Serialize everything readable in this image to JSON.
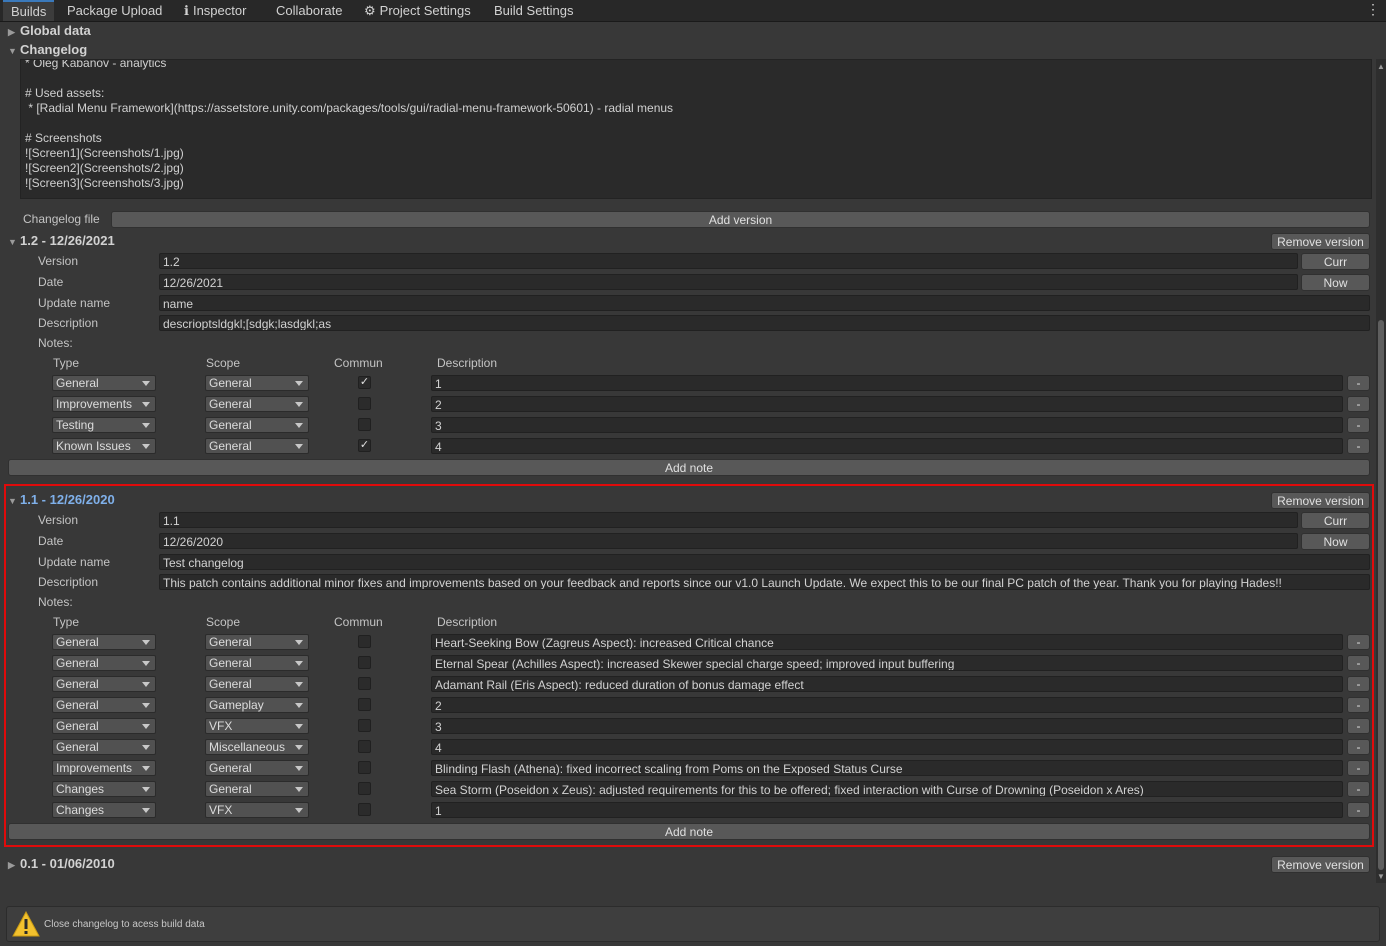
{
  "tabs": [
    "Builds",
    "Package Upload",
    "Inspector",
    "Collaborate",
    "Project Settings",
    "Build Settings"
  ],
  "tab_icons": {
    "inspector": "info-icon",
    "project_settings": "gear-icon"
  },
  "menu_glyph": "⋮",
  "sections": {
    "global_data": "Global data",
    "changelog": "Changelog"
  },
  "changelog_text": "* Oleg Kabanov - analytics\n\n# Used assets:\n * [Radial Menu Framework](https://assetstore.unity.com/packages/tools/gui/radial-menu-framework-50601) - radial menus\n\n# Screenshots\n![Screen1](Screenshots/1.jpg)\n![Screen2](Screenshots/2.jpg)\n![Screen3](Screenshots/3.jpg)",
  "changelog_file_label": "Changelog file",
  "add_version_label": "Add version",
  "labels": {
    "version": "Version",
    "date": "Date",
    "update_name": "Update name",
    "description": "Description",
    "notes": "Notes:",
    "col_type": "Type",
    "col_scope": "Scope",
    "col_commun": "Commun",
    "col_description": "Description",
    "curr": "Curr",
    "now": "Now",
    "remove_version": "Remove version",
    "add_note": "Add note",
    "minus": "-"
  },
  "versions": [
    {
      "header": "1.2 - 12/26/2021",
      "version": "1.2",
      "date": "12/26/2021",
      "update_name": "name",
      "description": "descrioptsldgkl;[sdgk;lasdgkl;as",
      "notes": [
        {
          "type": "General",
          "scope": "General",
          "commun": true,
          "description": "1"
        },
        {
          "type": "Improvements",
          "scope": "General",
          "commun": false,
          "description": "2"
        },
        {
          "type": "Testing",
          "scope": "General",
          "commun": false,
          "description": "3"
        },
        {
          "type": "Known Issues",
          "scope": "General",
          "commun": true,
          "description": "4"
        }
      ]
    },
    {
      "header": "1.1 - 12/26/2020",
      "selected": true,
      "version": "1.1",
      "date": "12/26/2020",
      "update_name": "Test changelog",
      "description": "This patch contains additional minor fixes and improvements based on your feedback and reports since our v1.0 Launch Update. We expect this to be our final PC patch of the year. Thank you for playing Hades!!",
      "notes": [
        {
          "type": "General",
          "scope": "General",
          "commun": false,
          "description": "Heart-Seeking Bow (Zagreus Aspect): increased Critical chance"
        },
        {
          "type": "General",
          "scope": "General",
          "commun": false,
          "description": "Eternal Spear (Achilles Aspect): increased Skewer special charge speed; improved input buffering"
        },
        {
          "type": "General",
          "scope": "General",
          "commun": false,
          "description": "Adamant Rail (Eris Aspect): reduced duration of bonus damage effect"
        },
        {
          "type": "General",
          "scope": "Gameplay",
          "commun": false,
          "description": "2"
        },
        {
          "type": "General",
          "scope": "VFX",
          "commun": false,
          "description": "3"
        },
        {
          "type": "General",
          "scope": "Miscellaneous",
          "commun": false,
          "description": "4"
        },
        {
          "type": "Improvements",
          "scope": "General",
          "commun": false,
          "description": "Blinding Flash (Athena): fixed incorrect scaling from Poms on the Exposed Status Curse"
        },
        {
          "type": "Changes",
          "scope": "General",
          "commun": false,
          "description": "Sea Storm (Poseidon x Zeus): adjusted requirements for this to be offered; fixed interaction with Curse of Drowning (Poseidon x Ares)"
        },
        {
          "type": "Changes",
          "scope": "VFX",
          "commun": false,
          "description": "1"
        }
      ]
    },
    {
      "header": "0.1 - 01/06/2010",
      "collapsed": true
    }
  ],
  "status_message": "Close changelog to acess build data",
  "warning_icon": "warning-icon"
}
